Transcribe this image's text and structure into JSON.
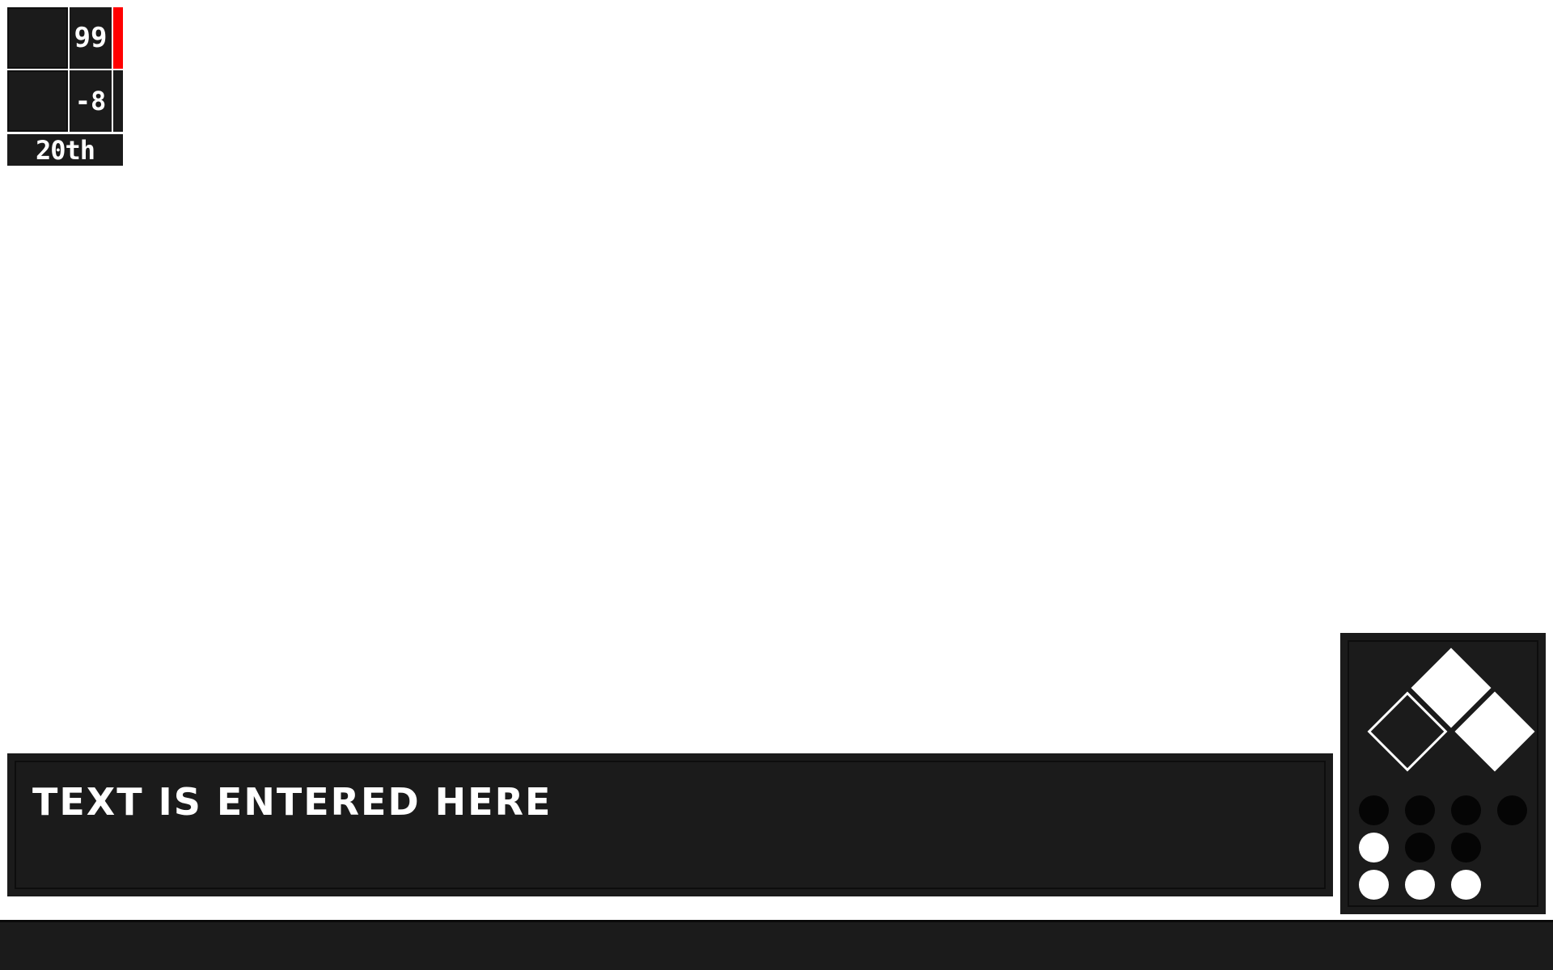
{
  "hud": {
    "stats": [
      {
        "value": "99",
        "bar_level": 1.0,
        "bar_color": "#ff0000"
      },
      {
        "value": "-8",
        "bar_level": 0.0,
        "bar_color": "#ff0000"
      }
    ],
    "rank": "20th"
  },
  "text_entry": {
    "value": "TEXT IS ENTERED HERE"
  },
  "control_panel": {
    "diamonds": [
      {
        "name": "diamond-top",
        "state": "filled"
      },
      {
        "name": "diamond-left",
        "state": "hollow"
      },
      {
        "name": "diamond-right",
        "state": "filled"
      }
    ],
    "dot_rows": [
      [
        "off",
        "off",
        "off",
        "off"
      ],
      [
        "on",
        "off",
        "off"
      ],
      [
        "on",
        "on",
        "on"
      ]
    ]
  },
  "colors": {
    "panel": "#1b1b1b",
    "accent": "#ff0000",
    "background": "#ffffff"
  }
}
